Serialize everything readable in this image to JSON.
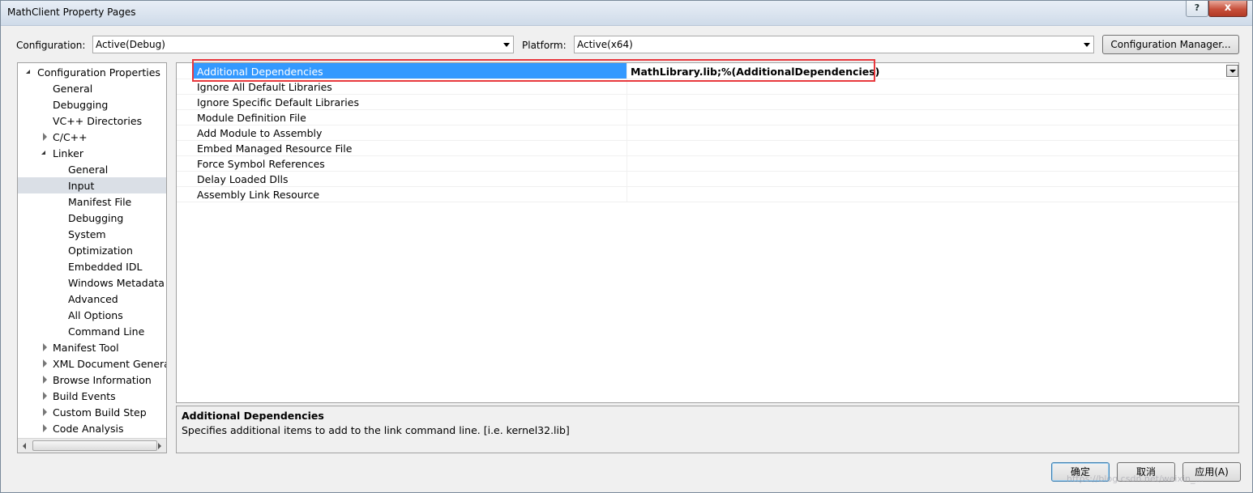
{
  "window": {
    "title": "MathClient Property Pages",
    "help_label": "?",
    "close_label": "x"
  },
  "toolbar": {
    "configuration_label": "Configuration:",
    "configuration_value": "Active(Debug)",
    "platform_label": "Platform:",
    "platform_value": "Active(x64)",
    "config_manager_label": "Configuration Manager..."
  },
  "tree": {
    "items": [
      {
        "label": "Configuration Properties",
        "expander": "open"
      },
      {
        "label": "General",
        "expander": "none"
      },
      {
        "label": "Debugging",
        "expander": "none"
      },
      {
        "label": "VC++ Directories",
        "expander": "none"
      },
      {
        "label": "C/C++",
        "expander": "closed"
      },
      {
        "label": "Linker",
        "expander": "open"
      },
      {
        "label": "General",
        "expander": "none"
      },
      {
        "label": "Input",
        "expander": "none",
        "selected": true
      },
      {
        "label": "Manifest File",
        "expander": "none"
      },
      {
        "label": "Debugging",
        "expander": "none"
      },
      {
        "label": "System",
        "expander": "none"
      },
      {
        "label": "Optimization",
        "expander": "none"
      },
      {
        "label": "Embedded IDL",
        "expander": "none"
      },
      {
        "label": "Windows Metadata",
        "expander": "none"
      },
      {
        "label": "Advanced",
        "expander": "none"
      },
      {
        "label": "All Options",
        "expander": "none"
      },
      {
        "label": "Command Line",
        "expander": "none"
      },
      {
        "label": "Manifest Tool",
        "expander": "closed"
      },
      {
        "label": "XML Document Generat",
        "expander": "closed"
      },
      {
        "label": "Browse Information",
        "expander": "closed"
      },
      {
        "label": "Build Events",
        "expander": "closed"
      },
      {
        "label": "Custom Build Step",
        "expander": "closed"
      },
      {
        "label": "Code Analysis",
        "expander": "closed"
      }
    ]
  },
  "properties": {
    "rows": [
      {
        "name": "Additional Dependencies",
        "value": "MathLibrary.lib;%(AdditionalDependencies)",
        "selected": true
      },
      {
        "name": "Ignore All Default Libraries",
        "value": ""
      },
      {
        "name": "Ignore Specific Default Libraries",
        "value": ""
      },
      {
        "name": "Module Definition File",
        "value": ""
      },
      {
        "name": "Add Module to Assembly",
        "value": ""
      },
      {
        "name": "Embed Managed Resource File",
        "value": ""
      },
      {
        "name": "Force Symbol References",
        "value": ""
      },
      {
        "name": "Delay Loaded Dlls",
        "value": ""
      },
      {
        "name": "Assembly Link Resource",
        "value": ""
      }
    ]
  },
  "description": {
    "title": "Additional Dependencies",
    "text": "Specifies additional items to add to the link command line. [i.e. kernel32.lib]"
  },
  "footer": {
    "ok_label": "确定",
    "cancel_label": "取消",
    "apply_label": "应用(A)",
    "watermark": "https://blog.csdn.net/weixin_..."
  },
  "colors": {
    "selection": "#3399ff",
    "highlight_box": "#e8383d",
    "tree_selection": "#dadfe6"
  }
}
